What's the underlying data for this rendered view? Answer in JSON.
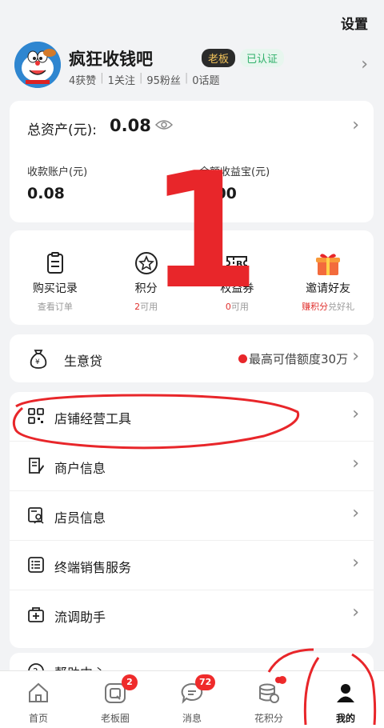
{
  "header": {
    "settings_label": "设置"
  },
  "profile": {
    "nickname": "疯狂收钱吧",
    "badge_boss": "老板",
    "badge_verified": "已认证",
    "stats": [
      "4获赞",
      "1关注",
      "95粉丝",
      "0话题"
    ]
  },
  "assets": {
    "total_label": "总资产(元):",
    "total_value": "0.08",
    "receipt_label": "收款账户(元)",
    "receipt_value": "0.08",
    "yuebao_label": "余额收益宝(元)",
    "yuebao_value": "0.00"
  },
  "overlay_annotation": {
    "number": "1",
    "color": "#e8262a"
  },
  "quick_actions": [
    {
      "title": "购买记录",
      "sub": "查看订单",
      "icon": "receipt-icon"
    },
    {
      "title": "积分",
      "sub_accent": "2",
      "sub": "可用",
      "icon": "star-icon"
    },
    {
      "title": "权益券",
      "sub_accent": "0",
      "sub": "可用",
      "icon": "coupon-icon"
    },
    {
      "title": "邀请好友",
      "sub_accent": "赚积分",
      "sub": "兑好礼",
      "icon": "gift-icon"
    }
  ],
  "loan": {
    "title": "生意贷",
    "right_text": "最高可借额度30万",
    "icon": "money-bag-icon"
  },
  "menu": [
    {
      "label": "店铺经营工具",
      "icon": "grid-icon"
    },
    {
      "label": "商户信息",
      "icon": "document-icon"
    },
    {
      "label": "店员信息",
      "icon": "staff-card-icon"
    },
    {
      "label": "终端销售服务",
      "icon": "list-icon"
    },
    {
      "label": "流调助手",
      "icon": "medical-kit-icon"
    }
  ],
  "help": {
    "label": "帮助中心"
  },
  "tabbar": {
    "tabs": [
      {
        "label": "首页",
        "icon": "home-icon"
      },
      {
        "label": "老板圈",
        "icon": "boss-circle-icon",
        "badge": "2"
      },
      {
        "label": "消息",
        "icon": "message-icon",
        "badge": "72"
      },
      {
        "label": "花积分",
        "icon": "coins-icon"
      },
      {
        "label": "我的",
        "icon": "user-icon",
        "active": true
      }
    ]
  },
  "colors": {
    "accent_red": "#e8262a",
    "verified_green": "#2fb06a",
    "boss_gold": "#f2c35a"
  }
}
